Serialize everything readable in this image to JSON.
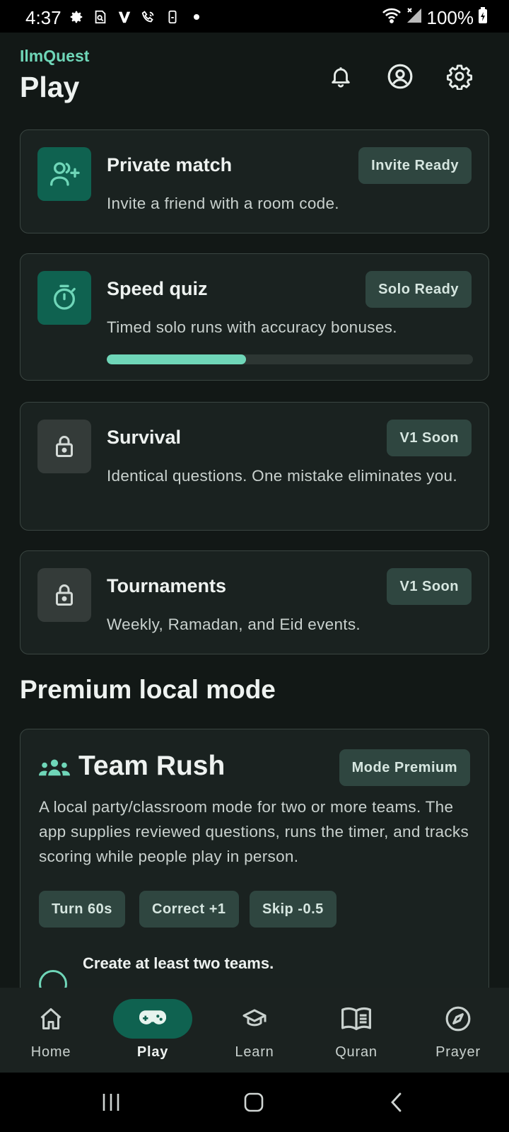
{
  "status_bar": {
    "time": "4:37",
    "battery": "100%"
  },
  "header": {
    "app_name": "IlmQuest",
    "title": "Play"
  },
  "modes": [
    {
      "title": "Private match",
      "badge": "Invite Ready",
      "description": "Invite a friend with a room code.",
      "icon": "user-plus-icon",
      "locked": false
    },
    {
      "title": "Speed quiz",
      "badge": "Solo Ready",
      "description": "Timed solo runs with accuracy bonuses.",
      "icon": "stopwatch-icon",
      "locked": false,
      "progress_fraction": 0.38
    },
    {
      "title": "Survival",
      "badge": "V1 Soon",
      "description": "Identical questions. One mistake eliminates you.",
      "icon": "lock-icon",
      "locked": true
    },
    {
      "title": "Tournaments",
      "badge": "V1 Soon",
      "description": "Weekly, Ramadan, and Eid events.",
      "icon": "lock-icon",
      "locked": true
    }
  ],
  "premium": {
    "section_title": "Premium local mode",
    "title": "Team Rush",
    "badge": "Mode Premium",
    "description": "A local party/classroom mode for two or more teams. The app supplies reviewed questions, runs the timer, and tracks scoring while people play in person.",
    "chips": [
      "Turn 60s",
      "Correct +1",
      "Skip -0.5"
    ],
    "step_title": "Create at least two teams."
  },
  "nav": {
    "items": [
      {
        "label": "Home",
        "icon": "home-icon"
      },
      {
        "label": "Play",
        "icon": "gamepad-icon"
      },
      {
        "label": "Learn",
        "icon": "graduation-cap-icon"
      },
      {
        "label": "Quran",
        "icon": "book-icon"
      },
      {
        "label": "Prayer",
        "icon": "compass-icon"
      }
    ],
    "active": "Play"
  },
  "colors": {
    "accent": "#6fd6b8",
    "accent_dark": "#0f6250",
    "background": "#121816",
    "card": "#1a2220",
    "badge": "#2f4640"
  }
}
